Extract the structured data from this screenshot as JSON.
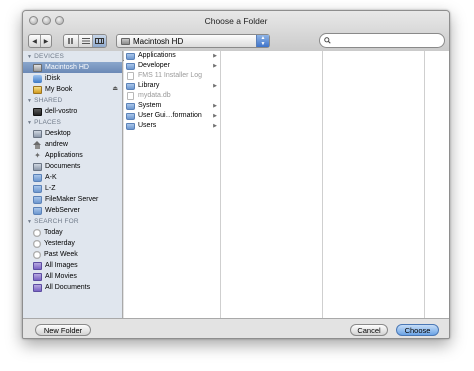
{
  "window": {
    "title": "Choose a Folder"
  },
  "toolbar": {
    "back_icon": "back-arrow-icon",
    "forward_icon": "forward-arrow-icon",
    "view_modes": [
      "icon-view-icon",
      "list-view-icon",
      "column-view-icon"
    ],
    "active_view": "column-view-icon",
    "location": "Macintosh HD",
    "search_placeholder": ""
  },
  "sidebar": {
    "devices_label": "DEVICES",
    "devices": [
      {
        "label": "Macintosh HD",
        "icon": "hard-drive-icon",
        "selected": true
      },
      {
        "label": "iDisk",
        "icon": "idisk-icon"
      },
      {
        "label": "My Book",
        "icon": "external-drive-icon",
        "eject": true
      }
    ],
    "shared_label": "SHARED",
    "shared": [
      {
        "label": "dell-vostro",
        "icon": "pc-icon"
      }
    ],
    "places_label": "PLACES",
    "places": [
      {
        "label": "Desktop",
        "icon": "desktop-icon"
      },
      {
        "label": "andrew",
        "icon": "home-icon"
      },
      {
        "label": "Applications",
        "icon": "applications-icon"
      },
      {
        "label": "Documents",
        "icon": "documents-icon"
      },
      {
        "label": "A-K",
        "icon": "folder-icon"
      },
      {
        "label": "L-Z",
        "icon": "folder-icon"
      },
      {
        "label": "FileMaker Server",
        "icon": "folder-icon"
      },
      {
        "label": "WebServer",
        "icon": "folder-icon"
      }
    ],
    "search_label": "SEARCH FOR",
    "searches": [
      {
        "label": "Today",
        "icon": "clock-icon"
      },
      {
        "label": "Yesterday",
        "icon": "clock-icon"
      },
      {
        "label": "Past Week",
        "icon": "clock-icon"
      },
      {
        "label": "All Images",
        "icon": "smart-folder-icon"
      },
      {
        "label": "All Movies",
        "icon": "smart-folder-icon"
      },
      {
        "label": "All Documents",
        "icon": "smart-folder-icon"
      }
    ]
  },
  "browser": {
    "column1": [
      {
        "label": "Applications",
        "type": "folder",
        "has_children": true
      },
      {
        "label": "Developer",
        "type": "folder",
        "has_children": true
      },
      {
        "label": "FMS 11 Installer Log",
        "type": "file",
        "dimmed": true
      },
      {
        "label": "Library",
        "type": "folder",
        "has_children": true
      },
      {
        "label": "mydata.db",
        "type": "file",
        "dimmed": true
      },
      {
        "label": "System",
        "type": "folder",
        "has_children": true
      },
      {
        "label": "User Gui…formation",
        "type": "folder",
        "has_children": true
      },
      {
        "label": "Users",
        "type": "folder",
        "has_children": true
      }
    ]
  },
  "buttons": {
    "new_folder": "New Folder",
    "cancel": "Cancel",
    "choose": "Choose"
  }
}
